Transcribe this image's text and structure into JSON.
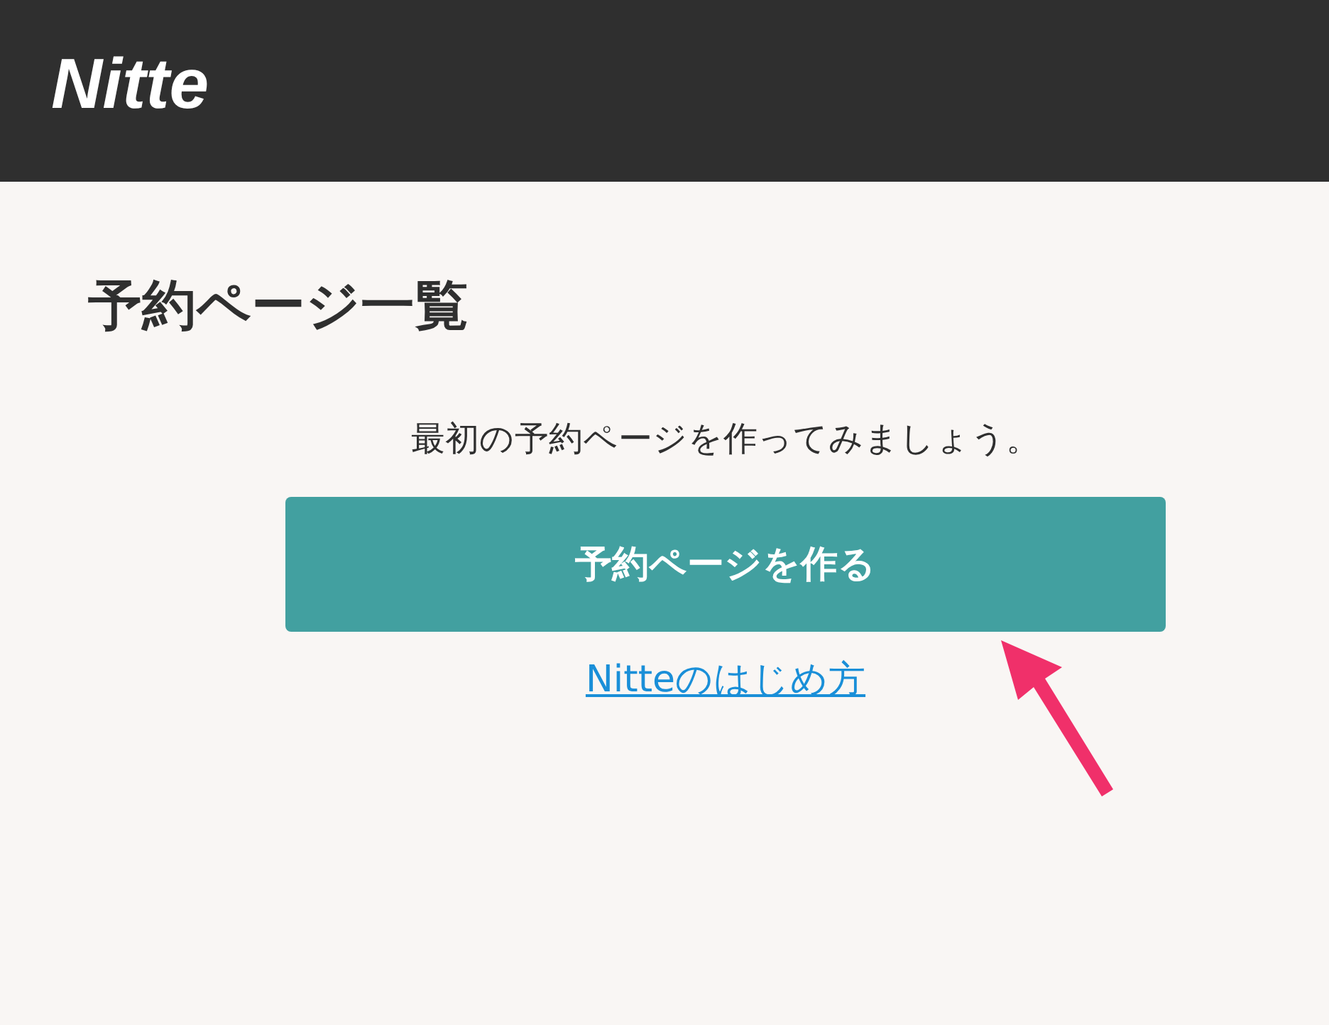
{
  "header": {
    "logo": "Nitte"
  },
  "page_title": "予約ページ一覧",
  "empty_message": "最初の予約ページを作ってみましょう。",
  "primary_button": "予約ページを作る",
  "help_link": "Nitteのはじめ方"
}
